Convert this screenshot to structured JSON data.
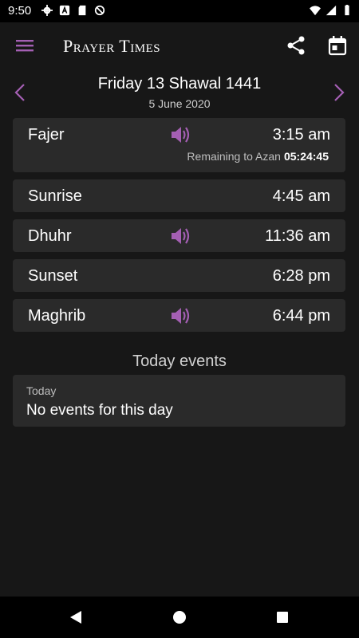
{
  "status_bar": {
    "time": "9:50",
    "icons_left": [
      "gear-icon",
      "a-box-icon",
      "sd-card-icon",
      "do-not-disturb-icon"
    ],
    "icons_right": [
      "wifi-icon",
      "signal-icon",
      "battery-icon"
    ]
  },
  "app_bar": {
    "title": "Prayer Times"
  },
  "date": {
    "hijri": "Friday 13 Shawal 1441",
    "gregorian": "5 June 2020"
  },
  "prayers": [
    {
      "name": "Fajer",
      "time": "3:15 am",
      "has_azan": true
    },
    {
      "name": "Sunrise",
      "time": "4:45 am",
      "has_azan": false
    },
    {
      "name": "Dhuhr",
      "time": "11:36 am",
      "has_azan": true
    },
    {
      "name": "Sunset",
      "time": "6:28 pm",
      "has_azan": false
    },
    {
      "name": "Maghrib",
      "time": "6:44 pm",
      "has_azan": true
    }
  ],
  "remaining": {
    "label": "Remaining to Azan",
    "countdown": "05:24:45"
  },
  "events": {
    "section_title": "Today events",
    "label": "Today",
    "text": "No events for this day"
  },
  "colors": {
    "accent": "#a45fb3",
    "background": "#171717",
    "card": "#2a2a2a"
  }
}
